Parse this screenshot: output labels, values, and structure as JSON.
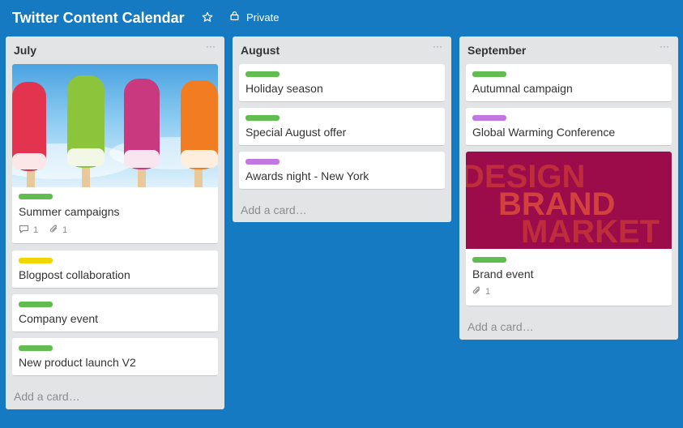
{
  "board": {
    "title": "Twitter Content Calendar",
    "visibility": "Private",
    "star_icon": "star-icon",
    "lock_icon": "lock-icon"
  },
  "colors": {
    "background": "#157ac1",
    "label_green": "#61bd4f",
    "label_yellow": "#f2d600",
    "label_purple": "#c377e0"
  },
  "lists": [
    {
      "title": "July",
      "menu": "···",
      "add_card": "Add a card…",
      "cards": [
        {
          "title": "Summer campaigns",
          "label": "green",
          "cover": "popsicles-image",
          "comments": "1",
          "attachments": "1"
        },
        {
          "title": "Blogpost collaboration",
          "label": "yellow"
        },
        {
          "title": "Company event",
          "label": "green"
        },
        {
          "title": "New product launch V2",
          "label": "green"
        }
      ]
    },
    {
      "title": "August",
      "menu": "···",
      "add_card": "Add a card…",
      "cards": [
        {
          "title": "Holiday season",
          "label": "green"
        },
        {
          "title": "Special August offer",
          "label": "green"
        },
        {
          "title": "Awards night - New York",
          "label": "purple"
        }
      ]
    },
    {
      "title": "September",
      "menu": "···",
      "add_card": "Add a card…",
      "cards": [
        {
          "title": "Autumnal campaign",
          "label": "green"
        },
        {
          "title": "Global Warming Conference",
          "label": "purple"
        },
        {
          "title": "Brand event",
          "label": "green",
          "cover": "design-brand-marketing-image",
          "attachments": "1"
        }
      ]
    }
  ],
  "cover_text": {
    "line1": "DESIGN",
    "line2": "BRAND",
    "line3": "MARKET"
  }
}
